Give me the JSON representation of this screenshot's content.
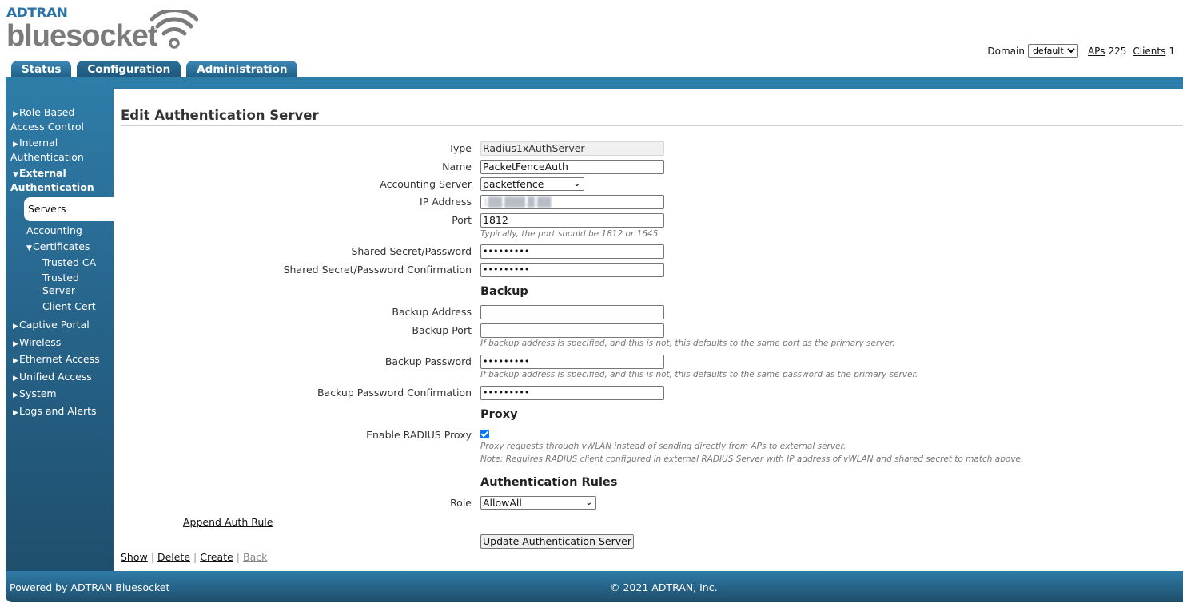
{
  "brand": {
    "company": "ADTRAN",
    "product": "bluesocket"
  },
  "topbar": {
    "domain_label": "Domain",
    "domain_value": "default",
    "aps_label": "APs",
    "aps_count": "225",
    "clients_label": "Clients",
    "clients_count": "1"
  },
  "tabs": [
    {
      "label": "Status",
      "active": false
    },
    {
      "label": "Configuration",
      "active": true
    },
    {
      "label": "Administration",
      "active": false
    }
  ],
  "sidebar": {
    "items": [
      {
        "label": "Role Based Access Control",
        "line1": "Role Based",
        "line2": "Access Control",
        "expanded": false
      },
      {
        "label": "Internal Authentication",
        "line1": "Internal",
        "line2": "Authentication",
        "expanded": false
      },
      {
        "label": "External Authentication",
        "line1": "External",
        "line2": "Authentication",
        "expanded": true
      },
      {
        "label": "Servers",
        "selected": true
      },
      {
        "label": "Accounting"
      },
      {
        "label": "Certificates",
        "expanded": true
      },
      {
        "label": "Trusted CA"
      },
      {
        "label": "Trusted Server",
        "line1": "Trusted",
        "line2": "Server"
      },
      {
        "label": "Client Cert"
      },
      {
        "label": "Captive Portal"
      },
      {
        "label": "Wireless"
      },
      {
        "label": "Ethernet Access"
      },
      {
        "label": "Unified Access"
      },
      {
        "label": "System"
      },
      {
        "label": "Logs and Alerts"
      }
    ]
  },
  "page": {
    "title": "Edit Authentication Server"
  },
  "form": {
    "type": {
      "label": "Type",
      "value": "Radius1xAuthServer"
    },
    "name": {
      "label": "Name",
      "value": "PacketFenceAuth"
    },
    "accounting_server": {
      "label": "Accounting Server",
      "value": "packetfence"
    },
    "ip_address": {
      "label": "IP Address",
      "value": "1██.███.█.██"
    },
    "port": {
      "label": "Port",
      "value": "1812",
      "hint": "Typically, the port should be 1812 or 1645."
    },
    "shared_secret": {
      "label": "Shared Secret/Password",
      "value": "•••••••••"
    },
    "shared_secret_confirm": {
      "label": "Shared Secret/Password Confirmation",
      "value": "•••••••••"
    },
    "backup_heading": "Backup",
    "backup_address": {
      "label": "Backup Address",
      "value": ""
    },
    "backup_port": {
      "label": "Backup Port",
      "value": "",
      "hint": "If backup address is specified, and this is not, this defaults to the same port as the primary server."
    },
    "backup_password": {
      "label": "Backup Password",
      "value": "•••••••••",
      "hint": "If backup address is specified, and this is not, this defaults to the same password as the primary server."
    },
    "backup_password_confirm": {
      "label": "Backup Password Confirmation",
      "value": "•••••••••"
    },
    "proxy_heading": "Proxy",
    "enable_proxy": {
      "label": "Enable RADIUS Proxy",
      "checked": true,
      "hint1": "Proxy requests through vWLAN instead of sending directly from APs to external server.",
      "hint2": "Note: Requires RADIUS client configured in external RADIUS Server with IP address of vWLAN and shared secret to match above."
    },
    "auth_rules_heading": "Authentication Rules",
    "role": {
      "label": "Role",
      "value": "AllowAll"
    },
    "append_rule_link": "Append Auth Rule",
    "submit_label": "Update Authentication Server"
  },
  "bottom_links": {
    "show": "Show",
    "delete": "Delete",
    "create": "Create",
    "back": "Back",
    "separator": "|"
  },
  "footer": {
    "left": "Powered by ADTRAN Bluesocket",
    "center": "© 2021 ADTRAN, Inc."
  },
  "colors": {
    "primary_blue": "#2e7ca8",
    "dark_blue": "#1f4e6b",
    "checkbox_accent": "#0075ff"
  }
}
